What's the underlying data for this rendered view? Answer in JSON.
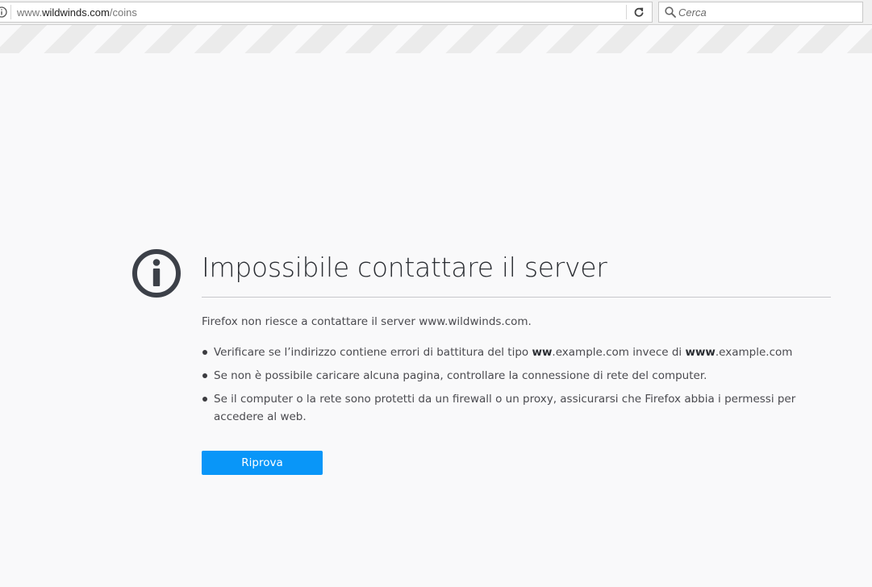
{
  "toolbar": {
    "url": {
      "prefix": "www.",
      "domain": "wildwinds.com",
      "path": "/coins"
    },
    "search": {
      "placeholder": "Cerca"
    },
    "icons": {
      "site_info": "info-icon",
      "reload": "reload-icon",
      "search": "search-icon"
    }
  },
  "error": {
    "icon": "info-circle-icon",
    "title": "Impossibile contattare il server",
    "description": "Firefox non riesce a contattare il server www.wildwinds.com.",
    "suggestions": {
      "typo": {
        "before": "Verificare se l’indirizzo contiene errori di battitura del tipo ",
        "bold1": "ww",
        "mid1": ".example.com invece di ",
        "bold2": "www",
        "mid2": ".example.com"
      },
      "connection": "Se non è possibile caricare alcuna pagina, controllare la connessione di rete del computer.",
      "firewall": "Se il computer o la rete sono protetti da un firewall o un proxy, assicurarsi che Firefox abbia i permessi per accedere al web."
    },
    "retry_label": "Riprova"
  },
  "colors": {
    "accent": "#0996f8",
    "title": "#2b2e33",
    "text": "#4a4a4f",
    "background": "#f9f9fa",
    "stripe": "#ebebeb"
  }
}
